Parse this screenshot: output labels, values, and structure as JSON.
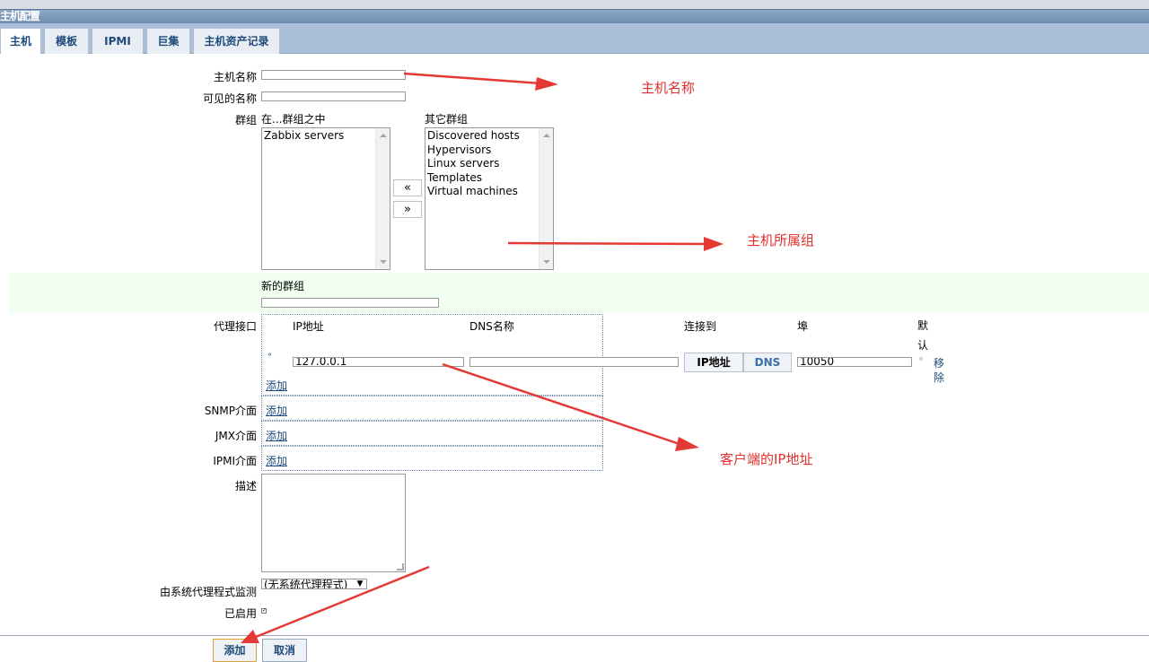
{
  "header": {
    "title": "主机配置"
  },
  "tabs": [
    {
      "label": "主机",
      "active": true
    },
    {
      "label": "模板"
    },
    {
      "label": "IPMI"
    },
    {
      "label": "巨集"
    },
    {
      "label": "主机资产记录"
    }
  ],
  "form": {
    "host_name_label": "主机名称",
    "host_name_value": "",
    "visible_name_label": "可见的名称",
    "visible_name_value": "",
    "groups_label": "群组",
    "in_groups_label": "在...群组之中",
    "in_groups": [
      "Zabbix servers"
    ],
    "other_groups_label": "其它群组",
    "other_groups": [
      "Discovered hosts",
      "Hypervisors",
      "Linux servers",
      "Templates",
      "Virtual machines"
    ],
    "move_left": "«",
    "move_right": "»",
    "new_group_label": "新的群组",
    "new_group_value": "",
    "agent_if_label": "代理接口",
    "col_ip": "IP地址",
    "col_dns": "DNS名称",
    "col_connect": "连接到",
    "col_port": "埠",
    "col_default_1": "默",
    "col_default_2": "认",
    "ip_value": "127.0.0.1",
    "dns_value": "",
    "connect_ip": "IP地址",
    "connect_dns": "DNS",
    "port_value": "10050",
    "remove_1": "移",
    "remove_2": "除",
    "add_link": "添加",
    "snmp_label": "SNMP介面",
    "jmx_label": "JMX介面",
    "ipmi_label": "IPMI介面",
    "desc_label": "描述",
    "desc_value": "",
    "proxy_label": "由系统代理程式监测",
    "proxy_value": "(无系统代理程式)",
    "enabled_label": "已启用"
  },
  "buttons": {
    "add": "添加",
    "cancel": "取消"
  },
  "annotations": {
    "host_name": "主机名称",
    "host_group": "主机所属组",
    "client_ip": "客户端的IP地址"
  },
  "colors": {
    "annotation": "#e03030",
    "link": "#1e4a7a",
    "tabbar": "#a9bed7",
    "highlight_band": "#f0fff0"
  }
}
